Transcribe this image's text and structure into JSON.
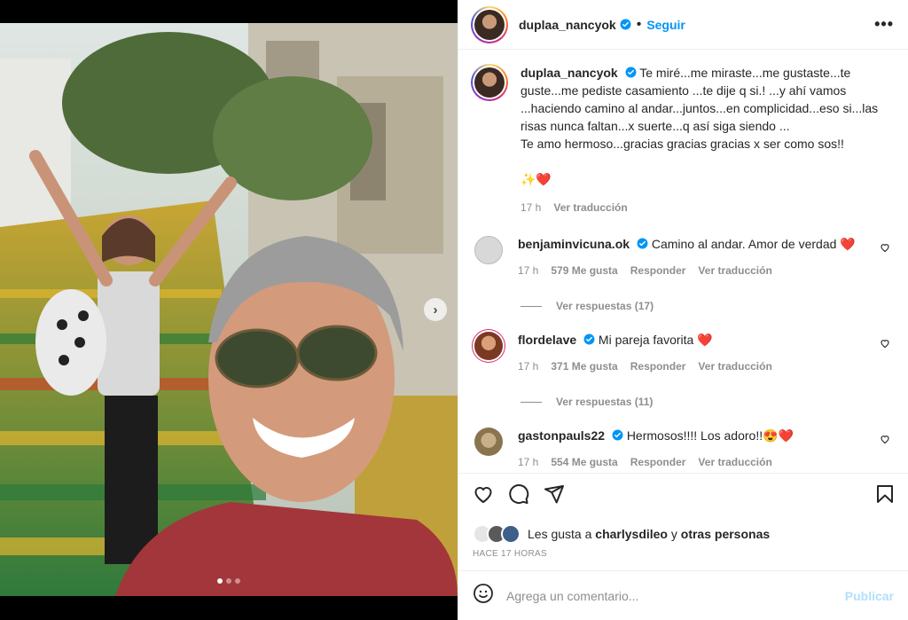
{
  "post": {
    "username": "duplaa_nancyok",
    "follow_label": "Seguir",
    "more_label": "•••",
    "separator": "•"
  },
  "caption": {
    "username": "duplaa_nancyok",
    "text": "Te miré...me miraste...me gustaste...te guste...me pediste casamiento ...te dije q si.! ...y ahí vamos ...haciendo camino al andar...juntos...en complicidad...eso si...las risas nunca faltan...x suerte...q así siga siendo ...\nTe amo hermoso...gracias gracias gracias x ser como sos!!\n\n✨❤️",
    "time": "17 h",
    "translate": "Ver traducción"
  },
  "comments": [
    {
      "username": "benjaminvicuna.ok",
      "text": "Camino al andar. Amor de verdad ❤️",
      "time": "17 h",
      "likes": "579 Me gusta",
      "reply": "Responder",
      "translate": "Ver traducción",
      "replies": "Ver respuestas (17)",
      "avatar_color": "#cfcfcf"
    },
    {
      "username": "flordelave",
      "text": "Mi pareja favorita ❤️",
      "time": "17 h",
      "likes": "371 Me gusta",
      "reply": "Responder",
      "translate": "Ver traducción",
      "replies": "Ver respuestas (11)",
      "avatar_color": "#a45a3a"
    },
    {
      "username": "gastonpauls22",
      "text": "Hermosos!!!! Los adoro!!😍❤️",
      "time": "17 h",
      "likes": "554 Me gusta",
      "reply": "Responder",
      "translate": "Ver traducción",
      "replies": "",
      "avatar_color": "#b9a071"
    }
  ],
  "likes_line": {
    "prefix": "Les gusta a ",
    "user": "charlysdileo",
    "middle": " y ",
    "others": "otras personas"
  },
  "posted": "HACE 17 HORAS",
  "add_comment": {
    "placeholder": "Agrega un comentario...",
    "publish": "Publicar"
  },
  "colors": {
    "accent": "#0095f6",
    "verified": "#0095f6",
    "publish_disabled": "#b2dffc"
  },
  "icons": [
    "heart-icon",
    "comment-icon",
    "share-icon",
    "bookmark-icon",
    "emoji-icon",
    "chevron-right-icon"
  ]
}
